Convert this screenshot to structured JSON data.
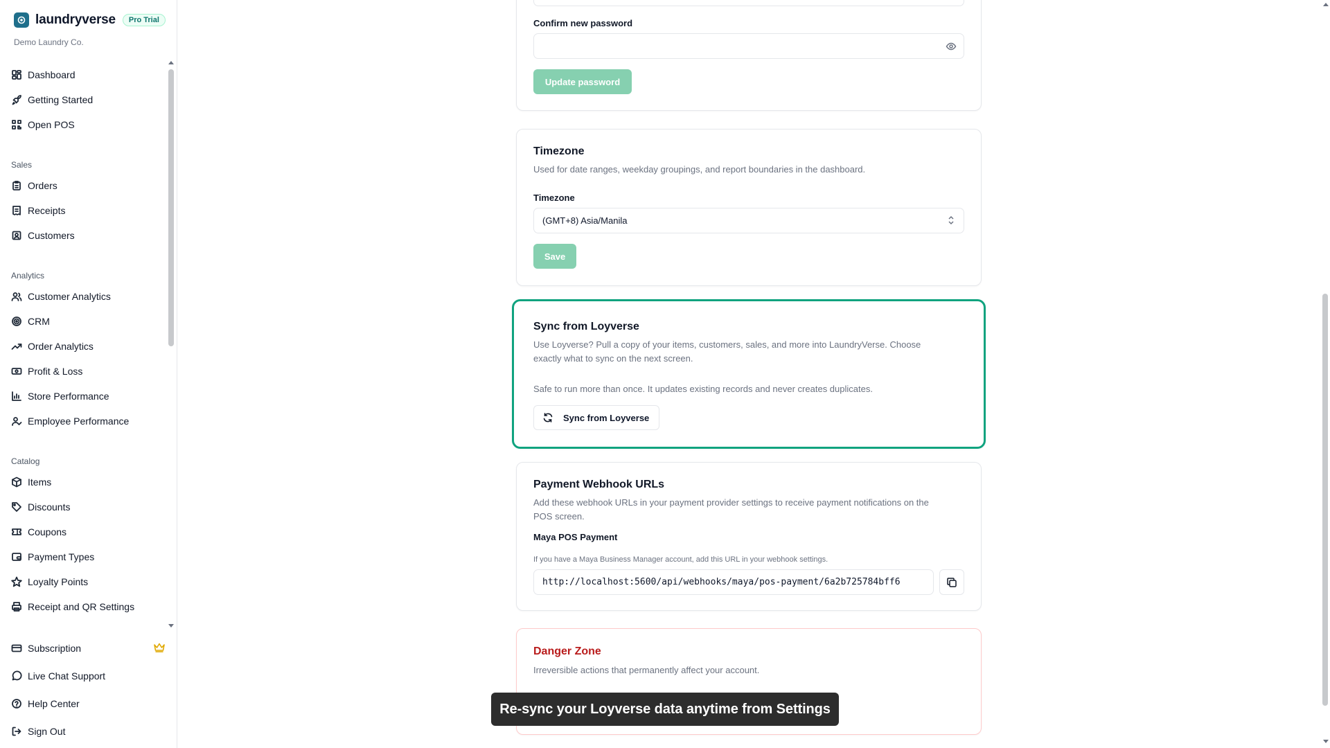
{
  "brand": {
    "name": "laundryverse",
    "badge": "Pro Trial",
    "company": "Demo Laundry Co."
  },
  "sidebar": {
    "top_items": [
      {
        "label": "Dashboard",
        "icon": "dashboard-icon"
      },
      {
        "label": "Getting Started",
        "icon": "rocket-icon"
      },
      {
        "label": "Open POS",
        "icon": "qr-grid-icon"
      }
    ],
    "sections": [
      {
        "title": "Sales",
        "items": [
          {
            "label": "Orders",
            "icon": "clipboard-icon"
          },
          {
            "label": "Receipts",
            "icon": "receipt-icon"
          },
          {
            "label": "Customers",
            "icon": "contact-icon"
          }
        ]
      },
      {
        "title": "Analytics",
        "items": [
          {
            "label": "Customer Analytics",
            "icon": "users-icon"
          },
          {
            "label": "CRM",
            "icon": "target-icon"
          },
          {
            "label": "Order Analytics",
            "icon": "trending-up-icon"
          },
          {
            "label": "Profit & Loss",
            "icon": "banknote-icon"
          },
          {
            "label": "Store Performance",
            "icon": "bar-chart-icon"
          },
          {
            "label": "Employee Performance",
            "icon": "user-check-icon"
          }
        ]
      },
      {
        "title": "Catalog",
        "items": [
          {
            "label": "Items",
            "icon": "package-icon"
          },
          {
            "label": "Discounts",
            "icon": "tag-icon"
          },
          {
            "label": "Coupons",
            "icon": "ticket-icon"
          },
          {
            "label": "Payment Types",
            "icon": "wallet-icon"
          },
          {
            "label": "Loyalty Points",
            "icon": "star-icon"
          },
          {
            "label": "Receipt and QR Settings",
            "icon": "printer-icon"
          }
        ]
      }
    ],
    "bottom_items": [
      {
        "label": "Subscription",
        "icon": "credit-card-icon"
      },
      {
        "label": "Live Chat Support",
        "icon": "message-circle-icon"
      },
      {
        "label": "Help Center",
        "icon": "help-circle-icon"
      },
      {
        "label": "Sign Out",
        "icon": "log-out-icon"
      }
    ]
  },
  "password": {
    "confirm_label": "Confirm new password",
    "confirm_value": "",
    "update_button": "Update password"
  },
  "timezone": {
    "title": "Timezone",
    "description": "Used for date ranges, weekday groupings, and report boundaries in the dashboard.",
    "field_label": "Timezone",
    "selected": "(GMT+8) Asia/Manila",
    "save_button": "Save"
  },
  "sync": {
    "title": "Sync from Loyverse",
    "description_1": "Use Loyverse? Pull a copy of your items, customers, sales, and more into LaundryVerse. Choose",
    "description_2": "exactly what to sync on the next screen.",
    "note": "Safe to run more than once. It updates existing records and never creates duplicates.",
    "button": "Sync from Loyverse",
    "highlight_color": "#10a37f"
  },
  "webhooks": {
    "title": "Payment Webhook URLs",
    "description_1": "Add these webhook URLs in your payment provider settings to receive payment notifications on the",
    "description_2": "POS screen.",
    "maya_label": "Maya POS Payment",
    "maya_hint": "If you have a Maya Business Manager account, add this URL in your webhook settings.",
    "maya_url": "http://localhost:5600/api/webhooks/maya/pos-payment/6a2b725784bff6"
  },
  "danger": {
    "title": "Danger Zone",
    "description": "Irreversible actions that permanently affect your account.",
    "title_color": "#b91c1c"
  },
  "toast": {
    "message": "Re-sync your Loyverse data anytime from Settings"
  }
}
